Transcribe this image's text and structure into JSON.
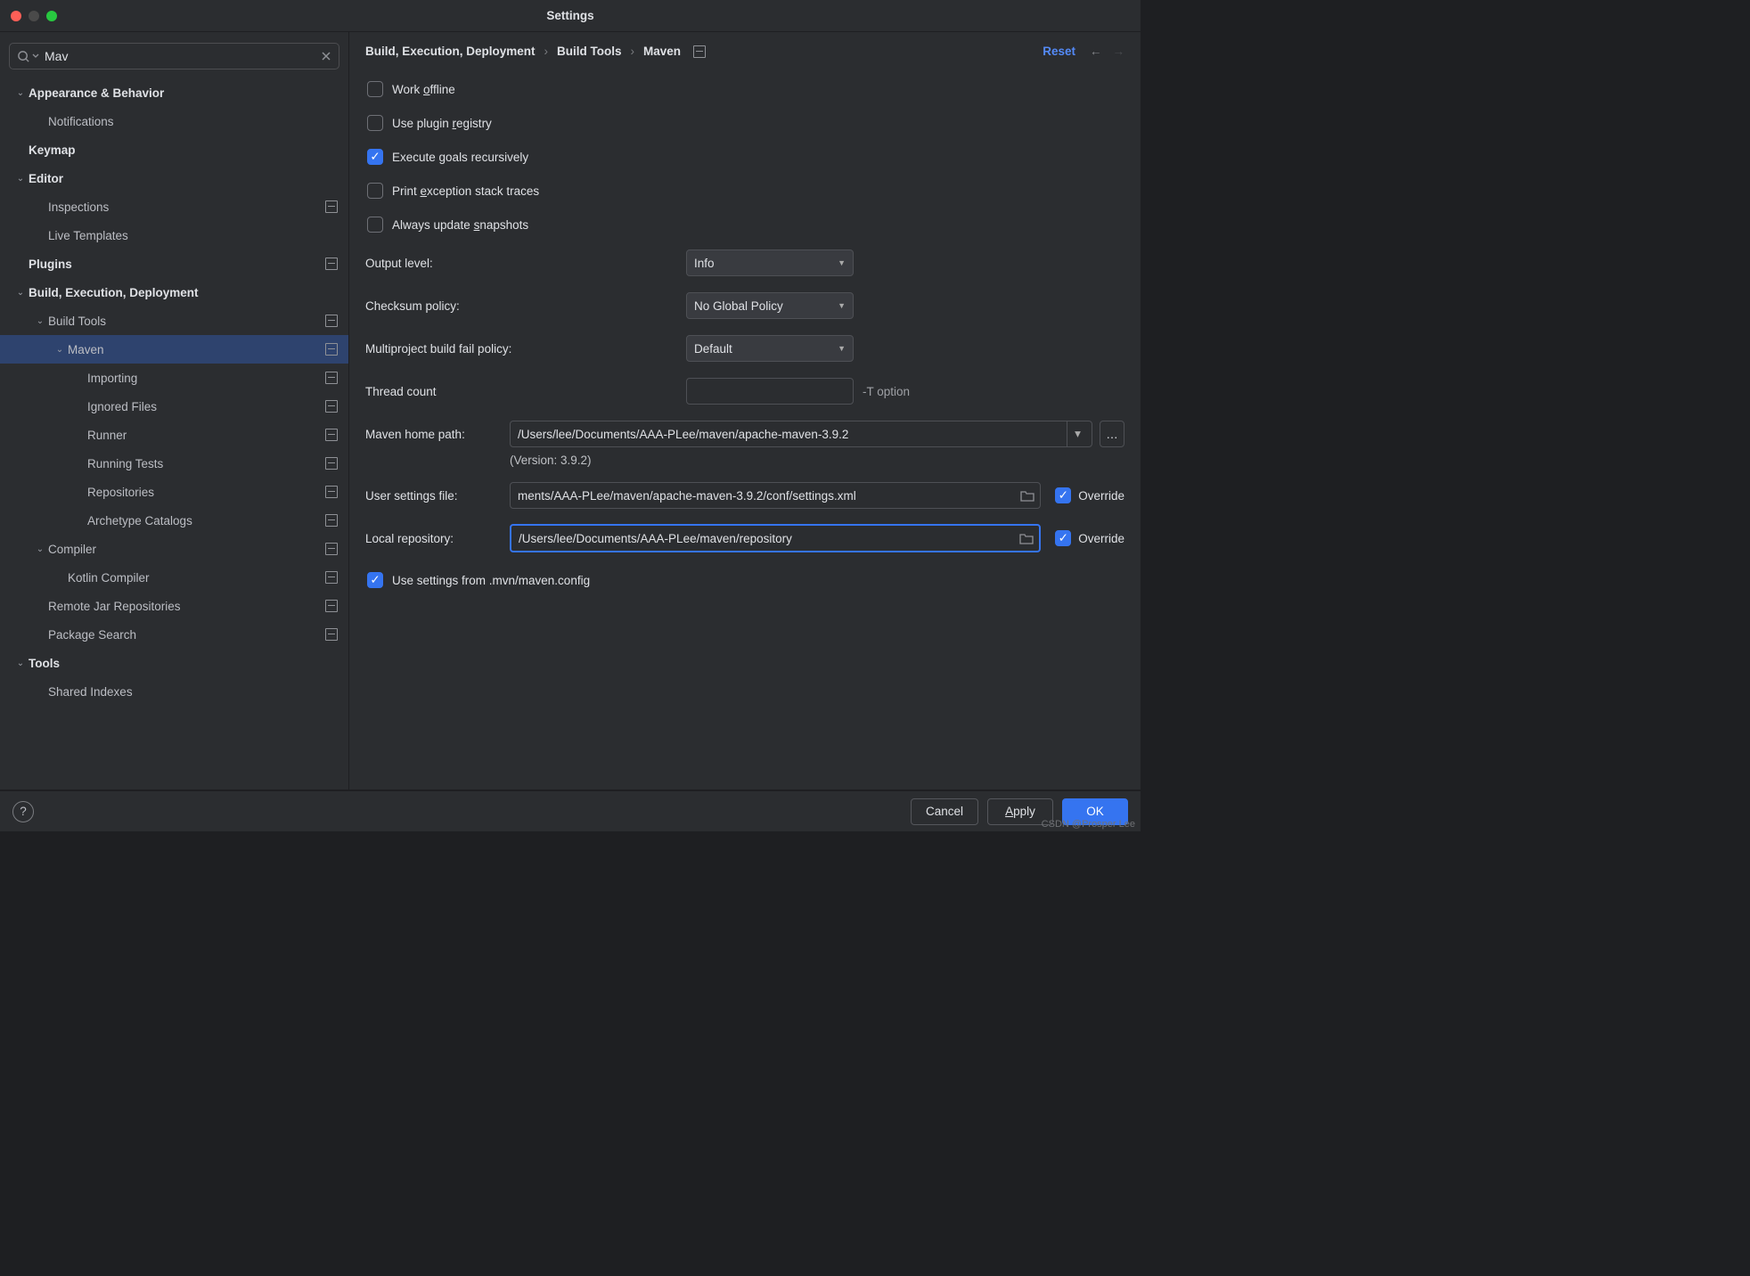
{
  "window": {
    "title": "Settings"
  },
  "search": {
    "value": "Mav"
  },
  "tree": [
    {
      "label": "Appearance & Behavior",
      "level": 0,
      "bold": true,
      "expandable": true,
      "expanded": true,
      "projIcon": false
    },
    {
      "label": "Notifications",
      "level": 1,
      "bold": false,
      "expandable": false,
      "projIcon": false
    },
    {
      "label": "Keymap",
      "level": 0,
      "bold": true,
      "expandable": false,
      "projIcon": false
    },
    {
      "label": "Editor",
      "level": 0,
      "bold": true,
      "expandable": true,
      "expanded": true,
      "projIcon": false
    },
    {
      "label": "Inspections",
      "level": 1,
      "bold": false,
      "expandable": false,
      "projIcon": true
    },
    {
      "label": "Live Templates",
      "level": 1,
      "bold": false,
      "expandable": false,
      "projIcon": false
    },
    {
      "label": "Plugins",
      "level": 0,
      "bold": true,
      "expandable": false,
      "projIcon": true
    },
    {
      "label": "Build, Execution, Deployment",
      "level": 0,
      "bold": true,
      "expandable": true,
      "expanded": true,
      "projIcon": false
    },
    {
      "label": "Build Tools",
      "level": 1,
      "bold": false,
      "expandable": true,
      "expanded": true,
      "projIcon": true
    },
    {
      "label": "Maven",
      "level": 2,
      "bold": false,
      "expandable": true,
      "expanded": true,
      "projIcon": true,
      "selected": true
    },
    {
      "label": "Importing",
      "level": 3,
      "bold": false,
      "expandable": false,
      "projIcon": true
    },
    {
      "label": "Ignored Files",
      "level": 3,
      "bold": false,
      "expandable": false,
      "projIcon": true
    },
    {
      "label": "Runner",
      "level": 3,
      "bold": false,
      "expandable": false,
      "projIcon": true
    },
    {
      "label": "Running Tests",
      "level": 3,
      "bold": false,
      "expandable": false,
      "projIcon": true
    },
    {
      "label": "Repositories",
      "level": 3,
      "bold": false,
      "expandable": false,
      "projIcon": true
    },
    {
      "label": "Archetype Catalogs",
      "level": 3,
      "bold": false,
      "expandable": false,
      "projIcon": true
    },
    {
      "label": "Compiler",
      "level": 1,
      "bold": false,
      "expandable": true,
      "expanded": true,
      "projIcon": true
    },
    {
      "label": "Kotlin Compiler",
      "level": 2,
      "bold": false,
      "expandable": false,
      "projIcon": true
    },
    {
      "label": "Remote Jar Repositories",
      "level": 1,
      "bold": false,
      "expandable": false,
      "projIcon": true
    },
    {
      "label": "Package Search",
      "level": 1,
      "bold": false,
      "expandable": false,
      "projIcon": true
    },
    {
      "label": "Tools",
      "level": 0,
      "bold": true,
      "expandable": true,
      "expanded": true,
      "projIcon": false
    },
    {
      "label": "Shared Indexes",
      "level": 1,
      "bold": false,
      "expandable": false,
      "projIcon": false
    }
  ],
  "breadcrumb": [
    "Build, Execution, Deployment",
    "Build Tools",
    "Maven"
  ],
  "reset_label": "Reset",
  "checkboxes": {
    "work_offline": {
      "label_pre": "Work ",
      "mn": "o",
      "label_post": "ffline",
      "checked": false
    },
    "plugin_registry": {
      "label_pre": "Use plugin ",
      "mn": "r",
      "label_post": "egistry",
      "checked": false
    },
    "execute_goals": {
      "label_pre": "Execute ",
      "mn": "g",
      "label_post": "oals recursively",
      "checked": true
    },
    "print_exception": {
      "label_pre": "Print ",
      "mn": "e",
      "label_post": "xception stack traces",
      "checked": false
    },
    "update_snapshots": {
      "label_pre": "Always update ",
      "mn": "s",
      "label_post": "napshots",
      "checked": false
    },
    "use_mvn_config": {
      "label": "Use settings from .mvn/maven.config",
      "checked": true
    }
  },
  "fields": {
    "output_level": {
      "label": "Output level:",
      "value": "Info"
    },
    "checksum_policy": {
      "label": "Checksum policy:",
      "value": "No Global Policy"
    },
    "multiproject": {
      "label": "Multiproject build fail policy:",
      "value": "Default"
    },
    "thread_count": {
      "label": "Thread count",
      "value": "",
      "hint": "-T option"
    },
    "maven_home": {
      "label": "Maven home path:",
      "value": "/Users/lee/Documents/AAA-PLee/maven/apache-maven-3.9.2"
    },
    "version_note": "(Version: 3.9.2)",
    "user_settings": {
      "label": "User settings file:",
      "value": "ments/AAA-PLee/maven/apache-maven-3.9.2/conf/settings.xml",
      "override_label": "Override",
      "override_checked": true
    },
    "local_repo": {
      "label": "Local repository:",
      "value": "/Users/lee/Documents/AAA-PLee/maven/repository",
      "override_label": "Override",
      "override_checked": true,
      "focused": true
    }
  },
  "buttons": {
    "cancel": "Cancel",
    "apply_pre": "",
    "apply_mn": "A",
    "apply_post": "pply",
    "ok": "OK"
  },
  "watermark": "CSDN @Prosper Lee"
}
